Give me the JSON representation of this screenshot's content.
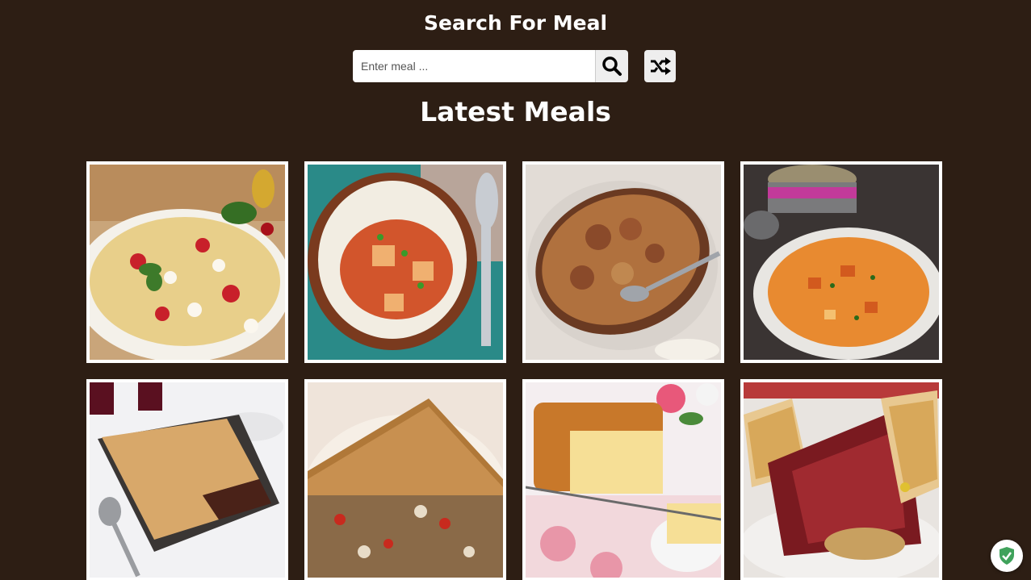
{
  "header": {
    "search_title": "Search For Meal",
    "latest_title": "Latest Meals"
  },
  "search": {
    "placeholder": "Enter meal ...",
    "value": "",
    "search_icon": "search-icon",
    "random_icon": "shuffle-icon"
  },
  "meals": [
    {
      "image": "farfalle-pasta-salad"
    },
    {
      "image": "stew-with-rice"
    },
    {
      "image": "baked-pasta-dish"
    },
    {
      "image": "curry-bowl"
    },
    {
      "image": "meat-pie"
    },
    {
      "image": "savory-pie-slice"
    },
    {
      "image": "pound-cake"
    },
    {
      "image": "beef-sandwich"
    }
  ],
  "colors": {
    "background": "#2d1e14",
    "text": "#ffffff",
    "button_bg": "#eeeeee",
    "badge_shield": "#3fa25b"
  },
  "badge": {
    "icon": "shield-check-icon"
  }
}
